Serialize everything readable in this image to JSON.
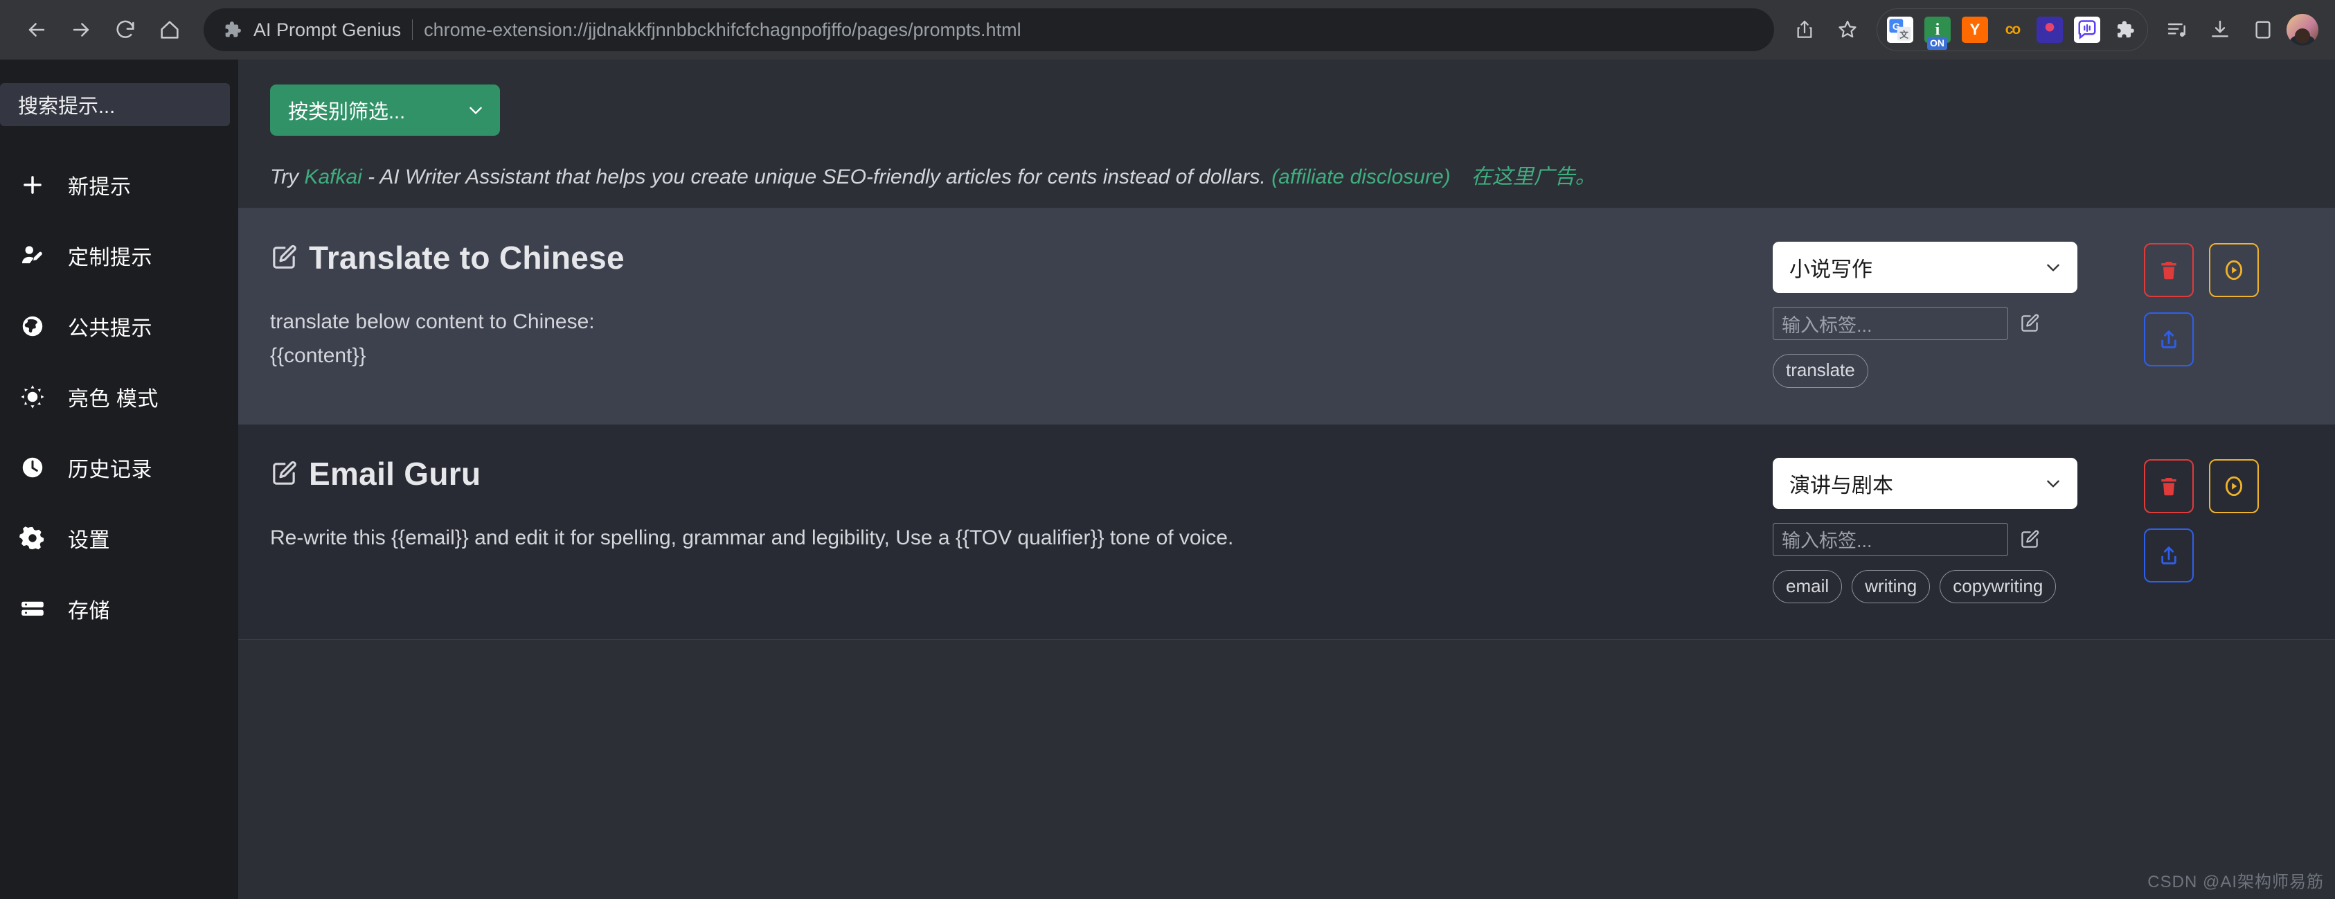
{
  "browser": {
    "nav": {
      "back": "back-arrow",
      "forward": "forward-arrow",
      "reload": "reload",
      "home": "home"
    },
    "omnibox": {
      "extension_name": "AI Prompt Genius",
      "url": "chrome-extension://jjdnakkfjnnbbckhifcfchagnpofjffo/pages/prompts.html",
      "puzzle_icon": "extension-puzzle-icon"
    },
    "toolbar_icons": {
      "share": "share-icon",
      "bookmark": "bookmark-star-icon",
      "extensions": "extensions-puzzle-icon",
      "reading_list": "reading-list-icon",
      "downloads": "downloads-icon",
      "side_panel": "side-panel-icon",
      "profile": "profile-avatar"
    },
    "extensions": [
      {
        "name": "google-translate-extension",
        "glyph": "G",
        "bg": "#ffffff"
      },
      {
        "name": "grammar-extension",
        "glyph": "i",
        "bg": "#2f8f4e",
        "badge": "ON"
      },
      {
        "name": "yandex-extension",
        "glyph": "Y",
        "bg": "#ff6a00"
      },
      {
        "name": "coco-extension",
        "glyph": "co",
        "bg": "#2c2d31"
      },
      {
        "name": "brain-chat-extension",
        "glyph": "",
        "bg": "#3a2fa8"
      },
      {
        "name": "voice-chat-extension",
        "glyph": "",
        "bg": "#ffffff"
      }
    ]
  },
  "sidebar": {
    "search": {
      "placeholder": "搜索提示..."
    },
    "items": [
      {
        "label": "新提示",
        "icon": "plus-icon",
        "name": "sidebar-item-new-prompt"
      },
      {
        "label": "定制提示",
        "icon": "user-edit-icon",
        "name": "sidebar-item-custom-prompts"
      },
      {
        "label": "公共提示",
        "icon": "globe-icon",
        "name": "sidebar-item-public-prompts"
      },
      {
        "label": "亮色 模式",
        "icon": "sun-icon",
        "name": "sidebar-item-light-mode"
      },
      {
        "label": "历史记录",
        "icon": "clock-icon",
        "name": "sidebar-item-history"
      },
      {
        "label": "设置",
        "icon": "gear-icon",
        "name": "sidebar-item-settings"
      },
      {
        "label": "存储",
        "icon": "storage-icon",
        "name": "sidebar-item-storage"
      }
    ]
  },
  "main": {
    "filter_button": {
      "label": "按类别筛选...",
      "icon": "chevron-down-icon"
    },
    "ad": {
      "try": "Try ",
      "brand": "Kafkai",
      "text": " - AI Writer Assistant that helps you create unique SEO-friendly articles for cents instead of dollars. ",
      "disclosure": "(affiliate disclosure)",
      "advertise": "在这里广告。"
    },
    "tag_placeholder": "输入标签...",
    "prompts": [
      {
        "title": "Translate to Chinese",
        "body": "translate below content to Chinese:\n{{content}}",
        "category": "小说写作",
        "tags": [
          "translate"
        ]
      },
      {
        "title": "Email Guru",
        "body": "Re-write this {{email}} and edit it for spelling, grammar and legibility, Use a {{TOV qualifier}} tone of voice.",
        "category": "演讲与剧本",
        "tags": [
          "email",
          "writing",
          "copywriting"
        ]
      }
    ],
    "actions": {
      "delete": "delete-icon",
      "run": "run-icon",
      "share": "share-upload-icon"
    },
    "watermark": "CSDN @AI架构师易筋"
  },
  "colors": {
    "accent_green": "#319268",
    "link_green": "#3fae7e",
    "delete_red": "#e03b3b",
    "run_yellow": "#f0b32a",
    "share_blue": "#2f5fe8"
  }
}
